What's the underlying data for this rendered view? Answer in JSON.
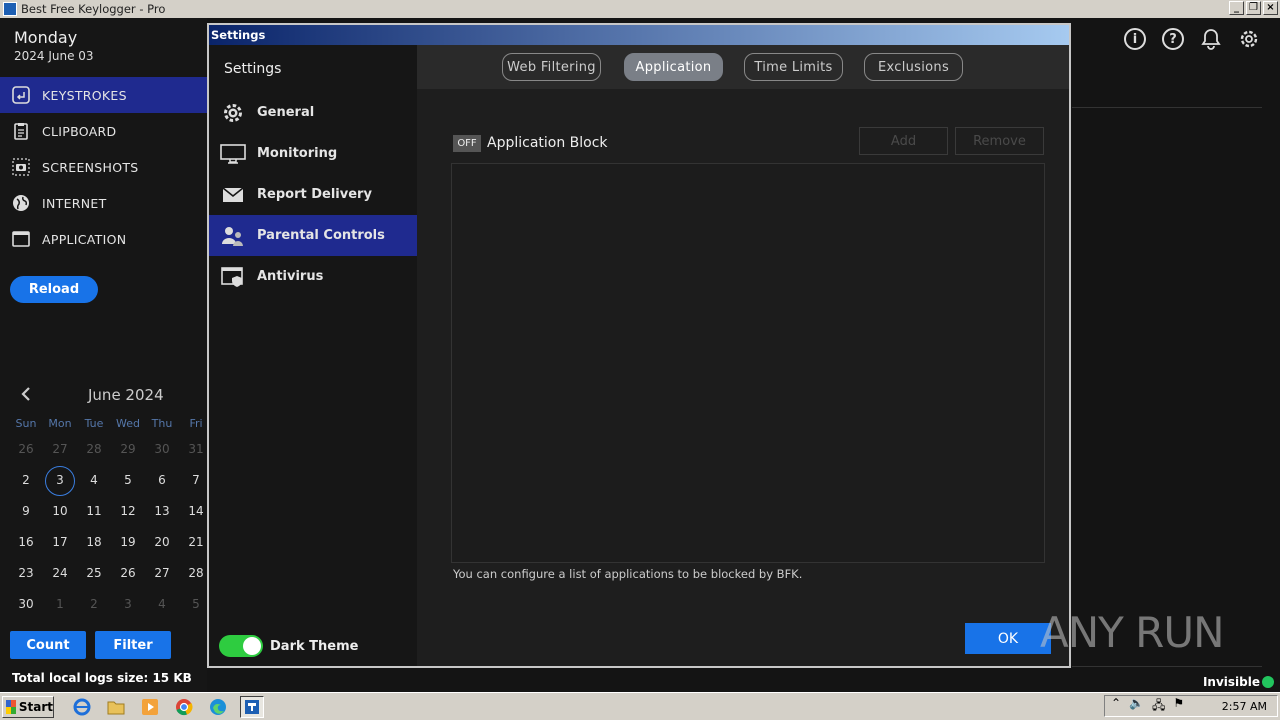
{
  "app": {
    "title": "Best Free Keylogger - Pro",
    "day": "Monday",
    "date": "2024 June 03"
  },
  "sidebar": {
    "items": [
      {
        "label": "KEYSTROKES",
        "icon": "keystroke-icon"
      },
      {
        "label": "CLIPBOARD",
        "icon": "clipboard-icon"
      },
      {
        "label": "SCREENSHOTS",
        "icon": "camera-icon"
      },
      {
        "label": "INTERNET",
        "icon": "globe-icon"
      },
      {
        "label": "APPLICATION",
        "icon": "window-icon"
      }
    ],
    "reload_label": "Reload",
    "count_label": "Count",
    "filter_label": "Filter",
    "logs_size": "Total local logs size: 15 KB"
  },
  "calendar": {
    "title": "June 2024",
    "weekdays": [
      "Sun",
      "Mon",
      "Tue",
      "Wed",
      "Thu",
      "Fri"
    ],
    "rows": [
      [
        "26",
        "27",
        "28",
        "29",
        "30",
        "31"
      ],
      [
        "2",
        "3",
        "4",
        "5",
        "6",
        "7"
      ],
      [
        "9",
        "10",
        "11",
        "12",
        "13",
        "14"
      ],
      [
        "16",
        "17",
        "18",
        "19",
        "20",
        "21"
      ],
      [
        "23",
        "24",
        "25",
        "26",
        "27",
        "28"
      ],
      [
        "30",
        "1",
        "2",
        "3",
        "4",
        "5"
      ]
    ]
  },
  "status": {
    "visibility": "Invisible"
  },
  "settings": {
    "window_title": "Settings",
    "side_title": "Settings",
    "menu": [
      {
        "label": "General",
        "icon": "gear-icon"
      },
      {
        "label": "Monitoring",
        "icon": "monitor-icon"
      },
      {
        "label": "Report Delivery",
        "icon": "envelope-icon"
      },
      {
        "label": "Parental Controls",
        "icon": "users-icon"
      },
      {
        "label": "Antivirus",
        "icon": "shield-window-icon"
      }
    ],
    "dark_theme_label": "Dark Theme",
    "tabs": [
      "Web Filtering",
      "Application",
      "Time Limits",
      "Exclusions"
    ],
    "off_label": "OFF",
    "app_block_label": "Application Block",
    "add_label": "Add",
    "remove_label": "Remove",
    "hint": "You can configure a list of applications to be blocked by BFK.",
    "ok_label": "OK"
  },
  "watermark": "ANY RUN",
  "taskbar": {
    "start_label": "Start",
    "clock": "2:57 AM"
  },
  "colors": {
    "accent": "#1873e8",
    "active_nav": "#1f2a8f",
    "toggle_on": "#2ecc40"
  }
}
